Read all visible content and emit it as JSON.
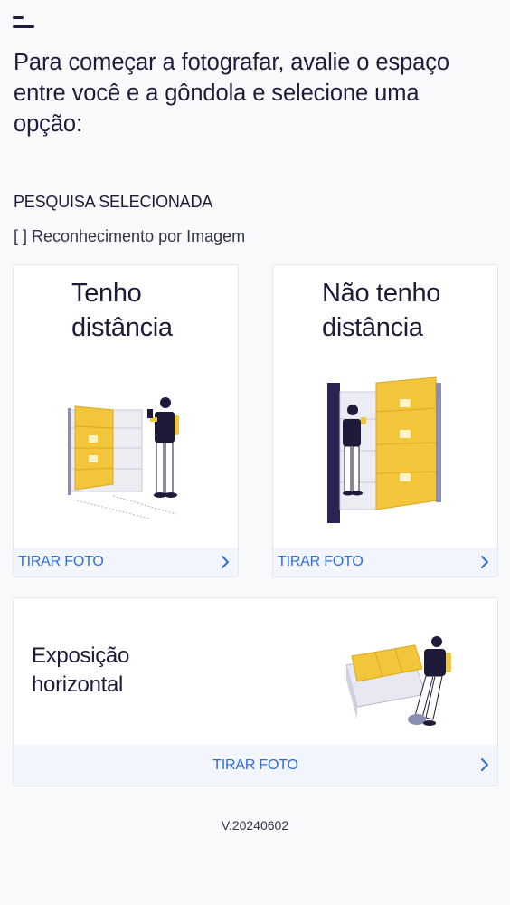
{
  "header": {
    "menu_icon": "menu-icon"
  },
  "intro": {
    "heading": "Para começar a fotografar, avalie o espaço entre você e a gôndola e selecione uma opção:"
  },
  "survey": {
    "section_label": "PESQUISA SELECIONADA",
    "name": "[ ] Reconhecimento por Imagem"
  },
  "options": [
    {
      "title_line1": "Tenho",
      "title_line2": "distância",
      "action_label": "TIRAR FOTO",
      "illustration": "shelf-with-distance-illustration"
    },
    {
      "title_line1": "Não tenho",
      "title_line2": "distância",
      "action_label": "TIRAR FOTO",
      "illustration": "shelf-without-distance-illustration"
    },
    {
      "title_line1": "Exposição",
      "title_line2": "horizontal",
      "action_label": "TIRAR FOTO",
      "illustration": "horizontal-display-illustration"
    }
  ],
  "colors": {
    "text_primary": "#1e1b3a",
    "accent_blue": "#2f6fd3",
    "card_footer_bg": "#f2f5fb",
    "illustration_yellow": "#f3c53b",
    "page_bg": "#f8f9fb"
  },
  "footer": {
    "version": "V.20240602"
  }
}
